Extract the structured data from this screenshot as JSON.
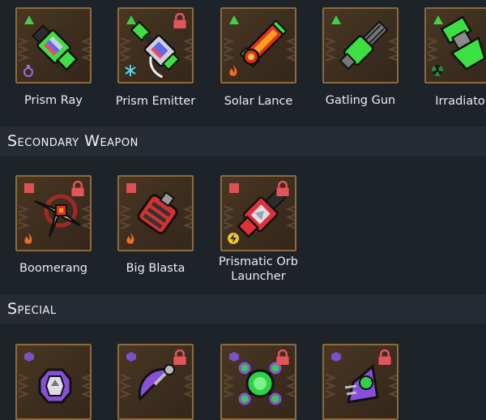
{
  "primary_weapons": [
    {
      "name": "Prism Ray",
      "tier": "green",
      "locked": false,
      "element": "prism-flask"
    },
    {
      "name": "Prism Emitter",
      "tier": "green",
      "locked": true,
      "element": "frost"
    },
    {
      "name": "Solar Lance",
      "tier": "green",
      "locked": false,
      "element": "fire"
    },
    {
      "name": "Gatling Gun",
      "tier": "green",
      "locked": false,
      "element": ""
    },
    {
      "name": "Irradiator",
      "tier": "green",
      "locked": false,
      "element": "radiation"
    }
  ],
  "sections": {
    "secondary": "Secondary Weapon",
    "special": "Special"
  },
  "secondary_weapons": [
    {
      "name": "Boomerang",
      "tier": "red",
      "locked": true,
      "element": "fire"
    },
    {
      "name": "Big Blasta",
      "tier": "red",
      "locked": false,
      "element": "fire"
    },
    {
      "name_line1": "Prismatic Orb",
      "name_line2": "Launcher",
      "tier": "red",
      "locked": true,
      "element": "lightning"
    }
  ],
  "specials": [
    {
      "tier": "purple",
      "locked": false
    },
    {
      "tier": "purple",
      "locked": true
    },
    {
      "tier": "purple",
      "locked": true
    },
    {
      "tier": "purple",
      "locked": true
    }
  ],
  "colors": {
    "background": "#1e2229",
    "header_bg": "#272b33",
    "tile_border": "#8a6a3e",
    "tier_green": "#3fd14a",
    "tier_red": "#e05050",
    "tier_purple": "#7d4fc9",
    "lock_red": "#e3545b"
  }
}
